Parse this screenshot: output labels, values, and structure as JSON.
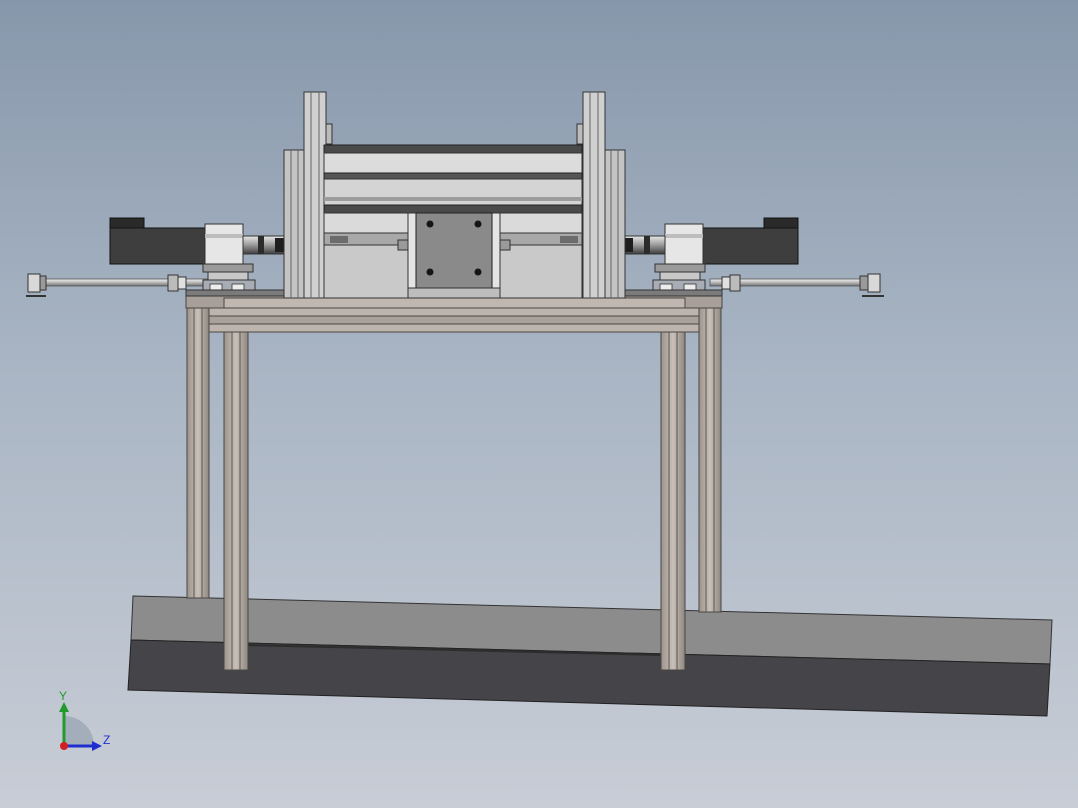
{
  "triad": {
    "y_label": "Y",
    "z_label": "Z",
    "x_color": "#d21f1f",
    "y_color": "#1f9a2b",
    "z_color": "#1f2fcf"
  },
  "colors": {
    "frame": "#b5ada5",
    "frame_edge": "#4a4642",
    "base_top": "#8c8c8c",
    "base_front": "#454448",
    "motor_dark": "#3e3e3e",
    "steel": "#d7d7d7",
    "plate": "#8a8a8a"
  }
}
